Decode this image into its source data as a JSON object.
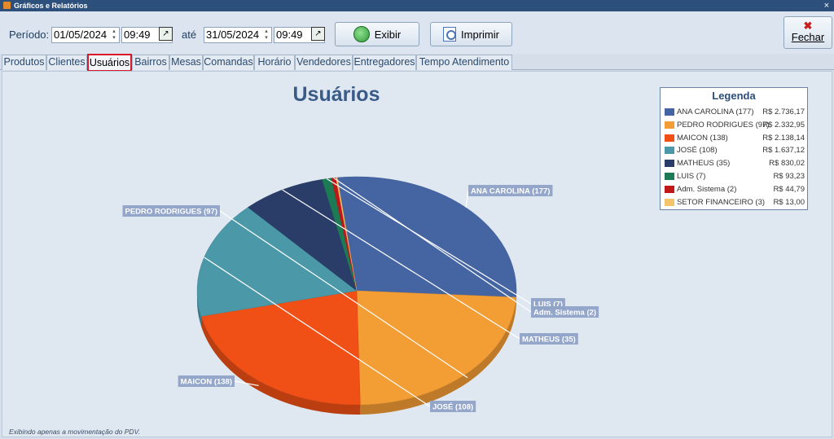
{
  "window": {
    "title": "Gráficos e Relatórios",
    "close_glyph": "×"
  },
  "toolbar": {
    "period_label": "Período:",
    "date_from": "01/05/2024",
    "time_from": "09:49",
    "until_label": "até",
    "date_to": "31/05/2024",
    "time_to": "09:49",
    "show_button": "Exibir",
    "print_button": "Imprimir",
    "close_button": "Fechar"
  },
  "tabs": [
    {
      "label": "Produtos"
    },
    {
      "label": "Clientes"
    },
    {
      "label": "Usuários",
      "active": true
    },
    {
      "label": "Bairros"
    },
    {
      "label": "Mesas"
    },
    {
      "label": "Comandas"
    },
    {
      "label": "Horário"
    },
    {
      "label": "Vendedores"
    },
    {
      "label": "Entregadores"
    },
    {
      "label": "Tempo Atendimento"
    }
  ],
  "legend": {
    "title": "Legenda"
  },
  "chart_data": {
    "type": "pie",
    "title": "Usuários",
    "legend_position": "top-right",
    "slices": [
      {
        "label": "ANA CAROLINA (177)",
        "legend_label": "ANA CAROLINA (177)",
        "value": 2736.17,
        "value_text": "R$ 2.736,17",
        "color": "#4565a2"
      },
      {
        "label": "PEDRO RODRIGUES (97)",
        "legend_label": "PEDRO RODRIGUES (97)",
        "value": 2332.95,
        "value_text": "R$ 2.332,95",
        "color": "#f39d35"
      },
      {
        "label": "MAICON (138)",
        "legend_label": "MAICON (138)",
        "value": 2138.14,
        "value_text": "R$ 2.138,14",
        "color": "#f04f16"
      },
      {
        "label": "JOSÉ (108)",
        "legend_label": "JOSÉ (108)",
        "value": 1637.12,
        "value_text": "R$ 1.637,12",
        "color": "#4b98a8"
      },
      {
        "label": "MATHEUS (35)",
        "legend_label": "MATHEUS (35)",
        "value": 830.02,
        "value_text": "R$ 830,02",
        "color": "#2a3c68"
      },
      {
        "label": "LUIS (7)",
        "legend_label": "LUIS (7)",
        "value": 93.23,
        "value_text": "R$ 93,23",
        "color": "#1c7b55"
      },
      {
        "label": "Adm. Sistema (2)",
        "legend_label": "Adm. Sistema (2)",
        "value": 44.79,
        "value_text": "R$ 44,79",
        "color": "#c01818"
      },
      {
        "label": "",
        "legend_label": "SETOR FINANCEIRO (3)",
        "value": 13.0,
        "value_text": "R$ 13,00",
        "color": "#f4c46a"
      }
    ]
  },
  "footnote": "Exibindo apenas a movimentação do PDV."
}
